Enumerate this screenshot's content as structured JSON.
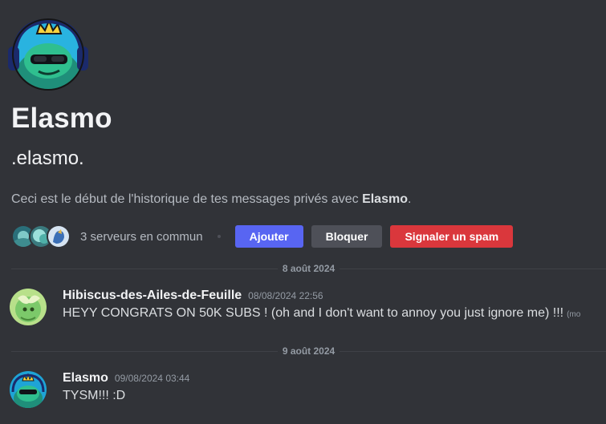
{
  "intro": {
    "display_name": "Elasmo",
    "username": ".elasmo.",
    "desc_prefix": "Ceci est le début de l'historique de tes messages privés avec ",
    "desc_name": "Elasmo",
    "desc_suffix": ".",
    "mutual_servers": "3 serveurs en commun",
    "add_button": "Ajouter",
    "block_button": "Bloquer",
    "spam_button": "Signaler un spam"
  },
  "messages": [
    {
      "date_divider": "8 août 2024",
      "author": "Hibiscus-des-Ailes-de-Feuille",
      "timestamp": "08/08/2024 22:56",
      "content": "HEYY CONGRATS ON 50K SUBS ! (oh and I don't want to annoy you just ignore me)  !!!",
      "edited": "(mo"
    },
    {
      "date_divider": "9 août 2024",
      "author": "Elasmo",
      "timestamp": "09/08/2024 03:44",
      "content": "TYSM!!! :D"
    }
  ],
  "colors": {
    "background": "#313338",
    "primary_button": "#5865f2",
    "secondary_button": "#4e5058",
    "danger_button": "#da373c"
  }
}
